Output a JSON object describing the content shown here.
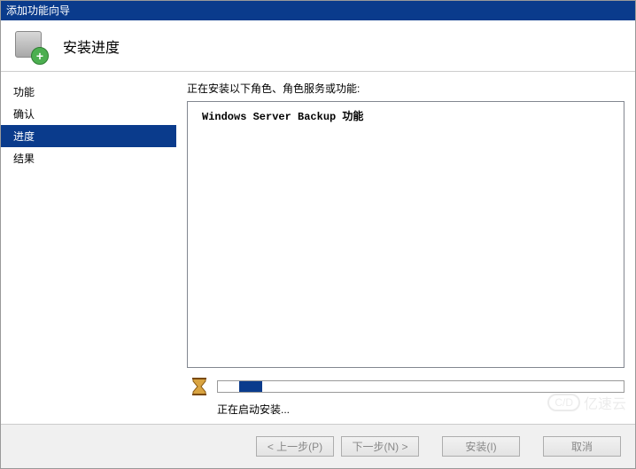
{
  "window": {
    "title": "添加功能向导"
  },
  "header": {
    "title": "安装进度"
  },
  "sidebar": {
    "items": [
      {
        "label": "功能",
        "active": false
      },
      {
        "label": "确认",
        "active": false
      },
      {
        "label": "进度",
        "active": true
      },
      {
        "label": "结果",
        "active": false
      }
    ]
  },
  "main": {
    "installing_label": "正在安装以下角色、角色服务或功能:",
    "list_items": [
      "Windows Server Backup 功能"
    ],
    "status_text": "正在启动安装..."
  },
  "footer": {
    "prev_label": "< 上一步(P)",
    "next_label": "下一步(N) >",
    "install_label": "安装(I)",
    "cancel_label": "取消"
  },
  "watermark": {
    "cloud": "C/D",
    "text": "亿速云"
  }
}
